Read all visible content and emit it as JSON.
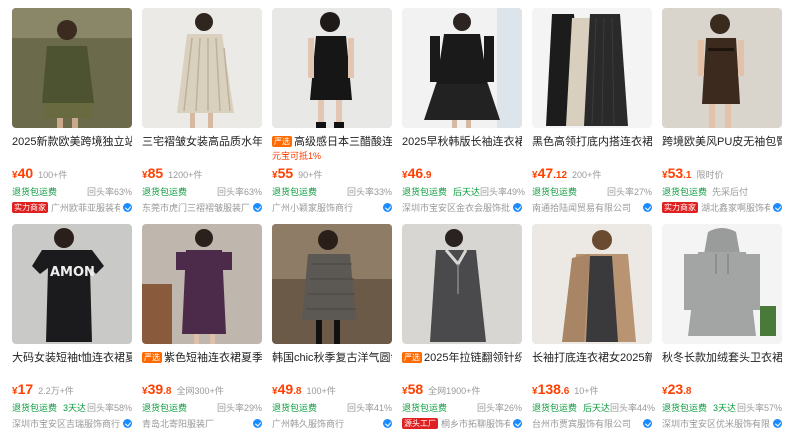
{
  "products": [
    {
      "title": "2025新款欧美跨境独立站高",
      "tag": "",
      "promo": "",
      "price": "40",
      "decimal": "",
      "sold": "100+件",
      "shipping": "退货包运费",
      "fast": "",
      "repurchase": "回头率63%",
      "badge": "实力商家",
      "shop": "广州欧菲亚服装有",
      "image": "olive-military-dress"
    },
    {
      "title": "三宅褶皱女装高品质水年轮",
      "tag": "",
      "promo": "",
      "price": "85",
      "decimal": "",
      "sold": "1200+件",
      "shipping": "退货包运费",
      "fast": "",
      "repurchase": "回头率63%",
      "badge": "",
      "shop": "东莞市虎门三褶褶皱服装厂",
      "image": "cream-pleated-dress"
    },
    {
      "title": "高级感日本三醋酸连衣",
      "tag": "严选",
      "promo": "元宝可抵1%",
      "price": "55",
      "decimal": "",
      "sold": "90+件",
      "shipping": "退货包运费",
      "fast": "",
      "repurchase": "回头率33%",
      "badge": "",
      "shop": "广州小颖家服饰商行",
      "image": "black-sleeveless-dress"
    },
    {
      "title": "2025早秋韩版长袖连衣裙简",
      "tag": "",
      "promo": "",
      "price": "46",
      "decimal": ".9",
      "sold": "",
      "shipping": "退货包运费",
      "fast": "后天达",
      "repurchase": "回头率49%",
      "badge": "",
      "shop": "深圳市宝安区金衣会服饰批",
      "image": "black-longsleeve-dress"
    },
    {
      "title": "黑色高领打底内搭连衣裙子",
      "tag": "",
      "promo": "",
      "price": "47",
      "decimal": ".12",
      "sold": "200+件",
      "shipping": "退货包运费",
      "fast": "",
      "repurchase": "回头率27%",
      "badge": "",
      "shop": "南通拾陆闻贸易有限公司",
      "image": "knit-turtleneck-dresses"
    },
    {
      "title": "跨境欧美风PU皮无袖包臀连",
      "tag": "",
      "promo": "",
      "price": "53",
      "decimal": ".1",
      "sold": "限时价",
      "shipping": "退货包运费",
      "fast": "",
      "repurchase": "先采后付",
      "badge": "实力商家",
      "shop": "湖北鑫家啊服饰有",
      "image": "brown-leather-dress"
    },
    {
      "title": "大码女装短袖t恤连衣裙夏季",
      "tag": "",
      "promo": "",
      "price": "17",
      "decimal": "",
      "sold": "2.2万+件",
      "shipping": "退货包运费",
      "fast": "3天达",
      "repurchase": "回头率58%",
      "badge": "",
      "shop": "深圳市宝安区吉瑞服饰商行",
      "image": "damon-tshirt-dress"
    },
    {
      "title": "紫色短袖连衣裙夏季新",
      "tag": "严选",
      "promo": "",
      "price": "39",
      "decimal": ".8",
      "sold": "全网300+件",
      "shipping": "退货包运费",
      "fast": "",
      "repurchase": "回头率29%",
      "badge": "",
      "shop": "青岛北寄阳服装厂",
      "image": "purple-midi-dress"
    },
    {
      "title": "韩国chic秋季复古洋气圆领",
      "tag": "",
      "promo": "",
      "price": "49",
      "decimal": ".8",
      "sold": "100+件",
      "shipping": "退货包运费",
      "fast": "",
      "repurchase": "回头率41%",
      "badge": "",
      "shop": "广州韩久服饰商行",
      "image": "grey-tweed-dress"
    },
    {
      "title": "2025年拉链翻领针织连",
      "tag": "严选",
      "promo": "",
      "price": "58",
      "decimal": "",
      "sold": "全网1900+件",
      "shipping": "退货包运费",
      "fast": "",
      "repurchase": "回头率26%",
      "badge": "源头工厂",
      "shop": "桐乡市拓聊服饰有",
      "image": "grey-knit-zip-dress"
    },
    {
      "title": "长袖打底连衣裙女2025新款",
      "tag": "",
      "promo": "",
      "price": "138",
      "decimal": ".6",
      "sold": "10+件",
      "shipping": "退货包运费",
      "fast": "后天达",
      "repurchase": "回头率44%",
      "badge": "",
      "shop": "台州市贾宾服饰有限公司",
      "image": "taupe-coat-dress"
    },
    {
      "title": "秋冬长款加绒套头卫衣裙女",
      "tag": "",
      "promo": "",
      "price": "23",
      "decimal": ".8",
      "sold": "",
      "shipping": "退货包运费",
      "fast": "3天达",
      "repurchase": "回头率57%",
      "badge": "",
      "shop": "深圳市宝安区优米服饰有限",
      "image": "grey-hoodie-dress"
    }
  ],
  "currency": "¥",
  "colors": {
    "price": "#ff4000",
    "shipping": "#0a9a3c",
    "badge": "#e02020",
    "tag": "#ff6a00"
  }
}
